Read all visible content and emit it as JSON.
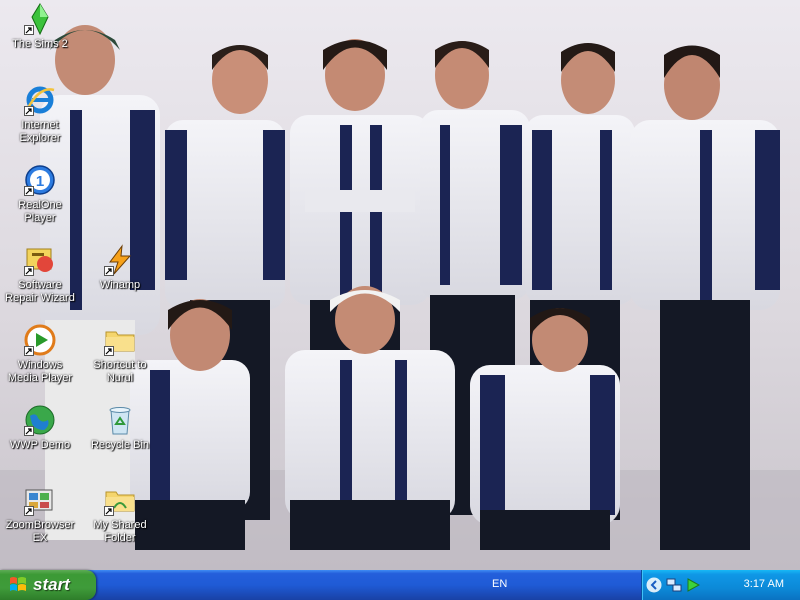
{
  "desktop": {
    "icons": [
      {
        "label": "The Sims 2",
        "icon": "sims-plumbob-icon",
        "shortcut": true
      },
      {
        "label": "Internet Explorer",
        "icon": "internet-explorer-icon",
        "shortcut": true
      },
      {
        "label": "RealOne Player",
        "icon": "realone-player-icon",
        "shortcut": true
      },
      {
        "label": "Software Repair Wizard",
        "icon": "repair-wizard-icon",
        "shortcut": true
      },
      {
        "label": "Winamp",
        "icon": "winamp-icon",
        "shortcut": true
      },
      {
        "label": "Windows Media Player",
        "icon": "windows-media-player-icon",
        "shortcut": true
      },
      {
        "label": "Shortcut to Nurul",
        "icon": "folder-icon",
        "shortcut": true
      },
      {
        "label": "WWP Demo",
        "icon": "globe-icon",
        "shortcut": true
      },
      {
        "label": "Recycle Bin",
        "icon": "recycle-bin-icon",
        "shortcut": false
      },
      {
        "label": "ZoomBrowser EX",
        "icon": "zoombrowser-icon",
        "shortcut": true
      },
      {
        "label": "My Shared Folder",
        "icon": "shared-folder-icon",
        "shortcut": true
      }
    ]
  },
  "taskbar": {
    "start_label": "start",
    "language": "EN",
    "clock": "3:17 AM"
  },
  "colors": {
    "taskbar_blue": "#245edb",
    "start_green": "#3c9a35",
    "tray_blue": "#0f97e6"
  }
}
